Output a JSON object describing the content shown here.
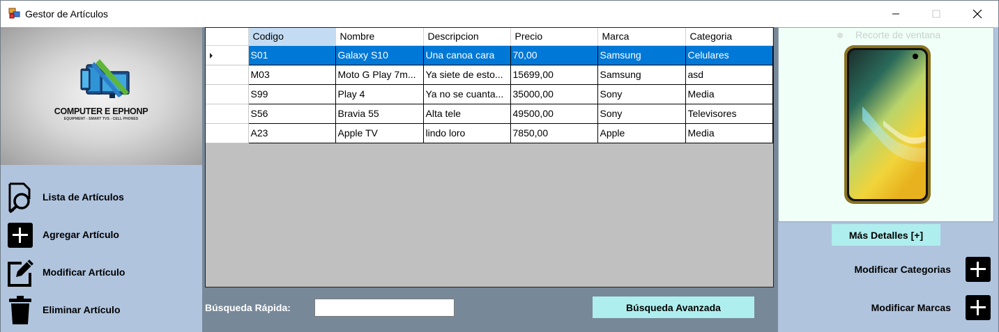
{
  "window": {
    "title": "Gestor de Artículos",
    "icons": {
      "app": "app-window-icon",
      "minimize": "minimize-icon",
      "maximize": "maximize-icon",
      "close": "close-icon"
    }
  },
  "logo": {
    "title": "COMPUTER E EPHONP",
    "subtitle": "EQUIPMENT - SMART TVS - CELL PHONES"
  },
  "nav": {
    "list": {
      "label": "Lista de Artículos",
      "icon": "document-search-icon"
    },
    "add": {
      "label": "Agregar Artículo",
      "icon": "plus-icon"
    },
    "edit": {
      "label": "Modificar Artículo",
      "icon": "edit-icon"
    },
    "delete": {
      "label": "Eliminar Artículo",
      "icon": "trash-icon"
    }
  },
  "grid": {
    "columns": [
      "Codigo",
      "Nombre",
      "Descripcion",
      "Precio",
      "Marca",
      "Categoria"
    ],
    "sorted_column": "Codigo",
    "rows": [
      [
        "S01",
        "Galaxy S10",
        "Una canoa cara",
        "70,00",
        "Samsung",
        "Celulares"
      ],
      [
        "M03",
        "Moto G Play 7m...",
        "Ya siete de esto...",
        "15699,00",
        "Samsung",
        "asd"
      ],
      [
        "S99",
        "Play 4",
        "Ya no se cuanta...",
        "35000,00",
        "Sony",
        "Media"
      ],
      [
        "S56",
        "Bravia 55",
        "Alta tele",
        "49500,00",
        "Sony",
        "Televisores"
      ],
      [
        "A23",
        "Apple TV",
        "lindo loro",
        "7850,00",
        "Apple",
        "Media"
      ]
    ],
    "selected_row": 0
  },
  "search": {
    "label": "Búsqueda Rápida:",
    "value": "",
    "advanced_label": "Búsqueda Avanzada"
  },
  "details": {
    "overlay_text": "Recorte de ventana",
    "more_label": "Más Detalles [+]",
    "edit_categories_label": "Modificar Categorias",
    "edit_brands_label": "Modificar Marcas"
  },
  "colors": {
    "panel": "#b0c4de",
    "center": "#778899",
    "accent_button": "#afeeee",
    "selection": "#0078d7"
  }
}
